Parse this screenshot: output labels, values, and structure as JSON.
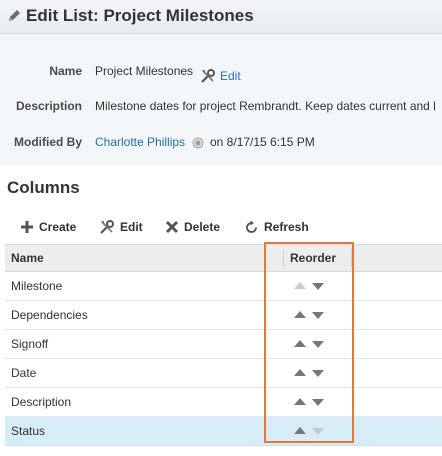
{
  "header": {
    "title": "Edit List: Project Milestones"
  },
  "details": {
    "name_label": "Name",
    "name_value": "Project Milestones",
    "edit_link": "Edit",
    "description_label": "Description",
    "description_value": "Milestone dates for project Rembrandt. Keep dates current and l",
    "modified_label": "Modified By",
    "modified_user": "Charlotte Phillips",
    "modified_date": "on 8/17/15 6:15 PM"
  },
  "columns_section": {
    "title": "Columns",
    "toolbar": {
      "create": "Create",
      "edit": "Edit",
      "delete": "Delete",
      "refresh": "Refresh"
    },
    "headers": {
      "name": "Name",
      "reorder": "Reorder"
    },
    "rows": [
      {
        "name": "Milestone",
        "up_enabled": false,
        "down_enabled": true
      },
      {
        "name": "Dependencies",
        "up_enabled": true,
        "down_enabled": true
      },
      {
        "name": "Signoff",
        "up_enabled": true,
        "down_enabled": true
      },
      {
        "name": "Date",
        "up_enabled": true,
        "down_enabled": true
      },
      {
        "name": "Description",
        "up_enabled": true,
        "down_enabled": true
      },
      {
        "name": "Status",
        "up_enabled": true,
        "down_enabled": false,
        "selected": true
      }
    ]
  },
  "colors": {
    "link": "#2b6bb3",
    "highlight_box": "#e07a3c",
    "selected_row": "#d6ecf7"
  }
}
